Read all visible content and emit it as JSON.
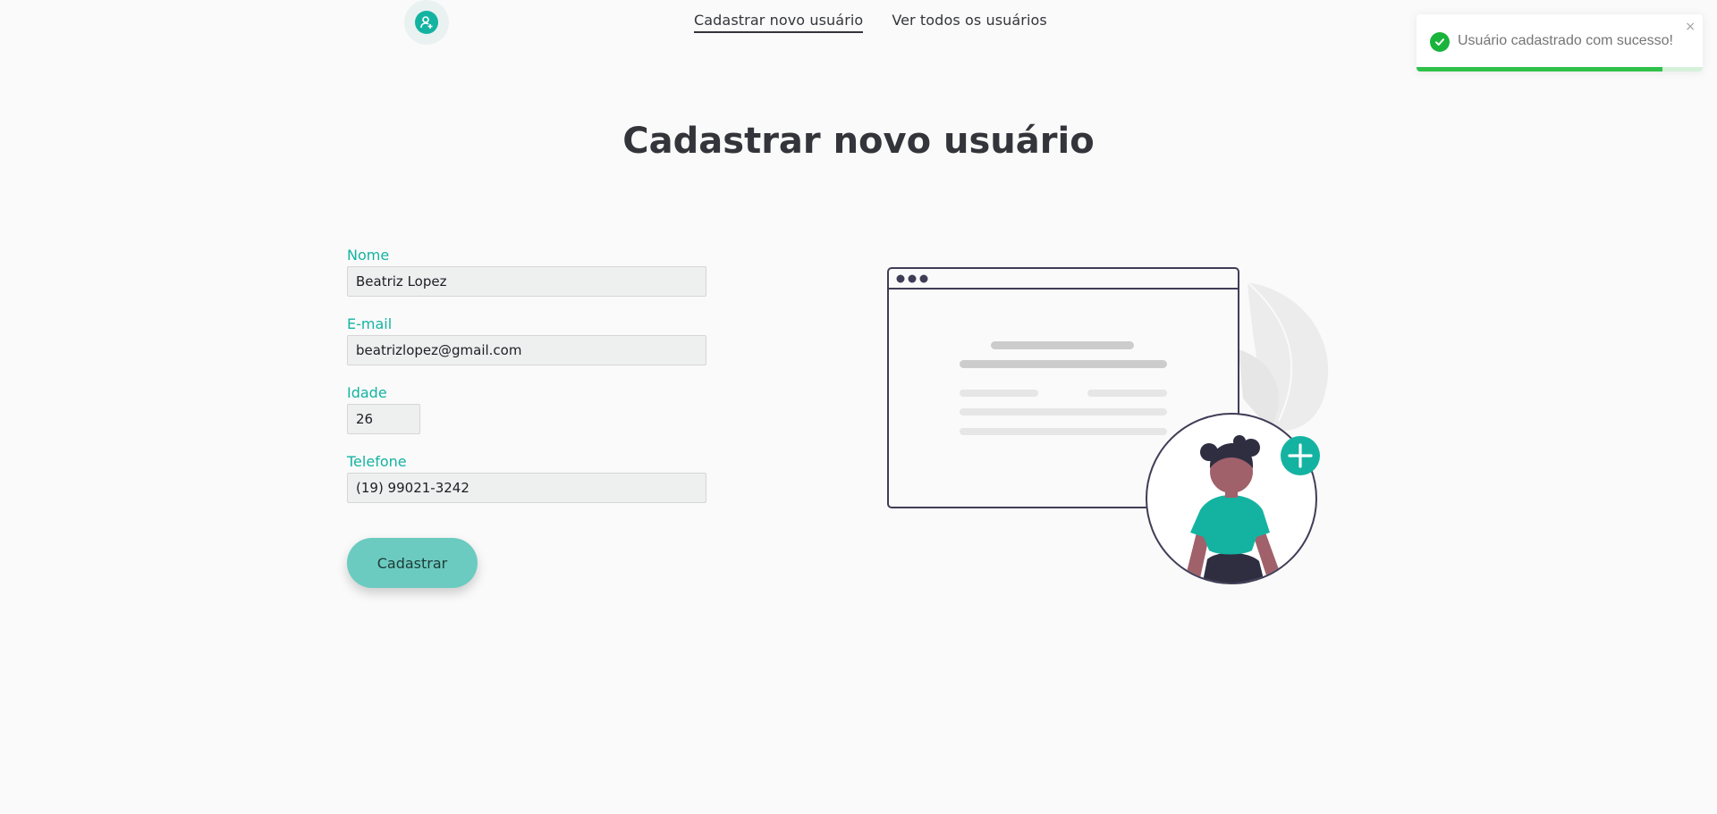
{
  "header": {
    "nav": [
      {
        "label": "Cadastrar novo usuário",
        "active": true
      },
      {
        "label": "Ver todos os usuários",
        "active": false
      }
    ]
  },
  "page": {
    "title": "Cadastrar novo usuário"
  },
  "form": {
    "fields": {
      "nome": {
        "label": "Nome",
        "value": "Beatriz Lopez"
      },
      "email": {
        "label": "E-mail",
        "value": "beatrizlopez@gmail.com"
      },
      "idade": {
        "label": "Idade",
        "value": "26"
      },
      "telefone": {
        "label": "Telefone",
        "value": "(19) 99021-3242"
      }
    },
    "submit_label": "Cadastrar"
  },
  "toast": {
    "message": "Usuário cadastrado com sucesso!",
    "close_glyph": "×",
    "progress": 0.86,
    "icon": "check-circle-icon"
  },
  "colors": {
    "accent": "#14b3a1",
    "button": "#6bcbc0",
    "text": "#34353b",
    "success": "#2fc14a",
    "figure_skin": "#a0616a",
    "figure_dark": "#2f2e41"
  }
}
